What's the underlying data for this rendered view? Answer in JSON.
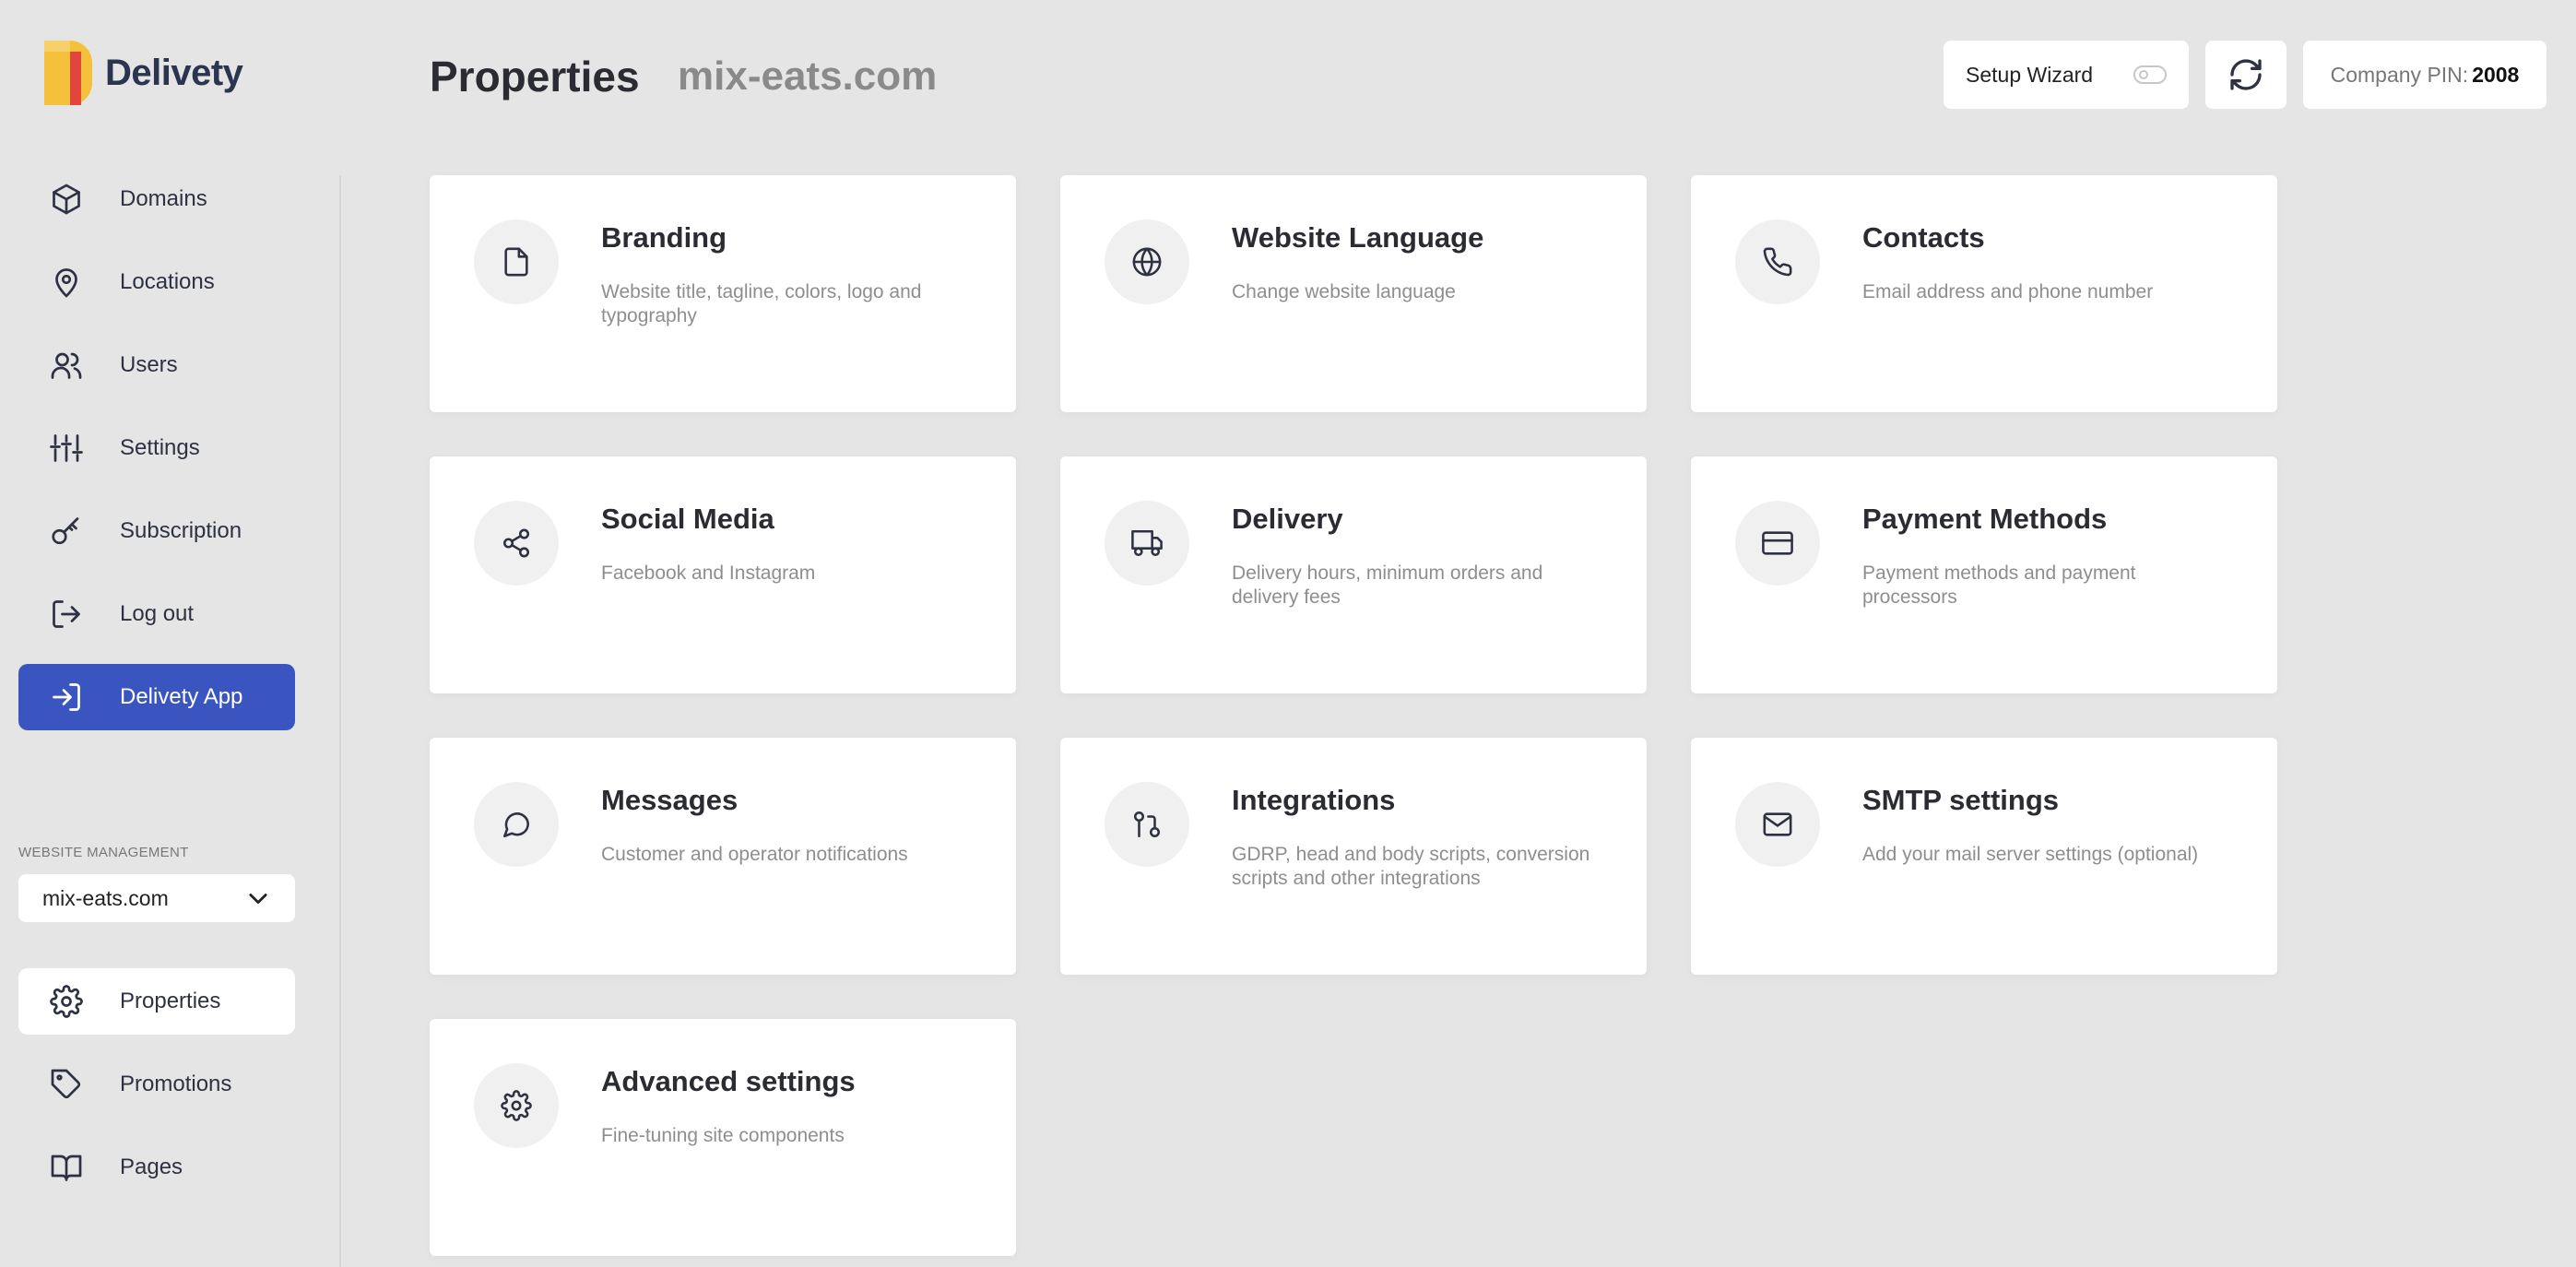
{
  "brand": {
    "name": "Delivety",
    "accent": "#3a55c0",
    "logo_colors": [
      "#f5c03b",
      "#e0443a"
    ]
  },
  "sidebar": {
    "items": [
      {
        "label": "Domains",
        "icon": "cube-icon"
      },
      {
        "label": "Locations",
        "icon": "map-pin-icon"
      },
      {
        "label": "Users",
        "icon": "users-icon"
      },
      {
        "label": "Settings",
        "icon": "sliders-icon"
      },
      {
        "label": "Subscription",
        "icon": "key-icon"
      },
      {
        "label": "Log out",
        "icon": "logout-icon"
      }
    ],
    "app_button": {
      "label": "Delivety App",
      "icon": "login-icon"
    },
    "website_management_label": "WEBSITE MANAGEMENT",
    "site_select_value": "mix-eats.com",
    "site_items": [
      {
        "label": "Properties",
        "icon": "gear-icon",
        "active": true
      },
      {
        "label": "Promotions",
        "icon": "tag-icon"
      },
      {
        "label": "Pages",
        "icon": "book-icon"
      }
    ]
  },
  "header": {
    "title": "Properties",
    "domain": "mix-eats.com",
    "setup_wizard_label": "Setup Wizard",
    "setup_wizard_enabled": false,
    "company_pin_label": "Company PIN:",
    "company_pin_value": "2008"
  },
  "cards": [
    {
      "title": "Branding",
      "desc": "Website title, tagline, colors, logo and typography",
      "icon": "file-icon"
    },
    {
      "title": "Website Language",
      "desc": "Change website language",
      "icon": "globe-icon"
    },
    {
      "title": "Contacts",
      "desc": "Email address and phone number",
      "icon": "phone-icon"
    },
    {
      "title": "Social Media",
      "desc": "Facebook and Instagram",
      "icon": "share-icon"
    },
    {
      "title": "Delivery",
      "desc": "Delivery hours, minimum orders and delivery fees",
      "icon": "truck-icon"
    },
    {
      "title": "Payment Methods",
      "desc": "Payment methods and payment processors",
      "icon": "credit-card-icon"
    },
    {
      "title": "Messages",
      "desc": "Customer and operator notifications",
      "icon": "chat-icon"
    },
    {
      "title": "Integrations",
      "desc": "GDRP, head and body scripts, conversion scripts and other integrations",
      "icon": "git-pull-icon"
    },
    {
      "title": "SMTP settings",
      "desc": "Add your mail server settings (optional)",
      "icon": "mail-icon"
    },
    {
      "title": "Advanced settings",
      "desc": "Fine-tuning site components",
      "icon": "gear-icon"
    }
  ]
}
